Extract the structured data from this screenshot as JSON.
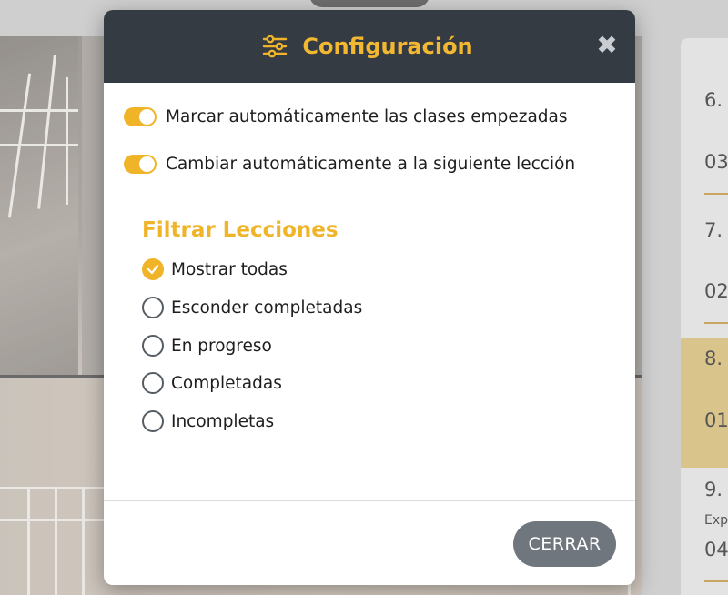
{
  "modal": {
    "title": "Configuración",
    "icon": "sliders-icon",
    "close_icon": "close-icon",
    "accent_color": "#f0b429",
    "header_color": "#353b42"
  },
  "toggles": [
    {
      "label": "Marcar automáticamente las clases empezadas",
      "on": true
    },
    {
      "label": "Cambiar automáticamente a la siguiente lección",
      "on": true
    }
  ],
  "filter": {
    "title": "Filtrar Lecciones",
    "options": [
      {
        "label": "Mostrar todas",
        "checked": true
      },
      {
        "label": "Esconder completadas",
        "checked": false
      },
      {
        "label": "En progreso",
        "checked": false
      },
      {
        "label": "Completadas",
        "checked": false
      },
      {
        "label": "Incompletas",
        "checked": false
      }
    ]
  },
  "footer": {
    "close_label": "CERRAR"
  },
  "background_lessons": [
    {
      "num": "6.",
      "time": "03"
    },
    {
      "num": "7.",
      "time": "02"
    },
    {
      "num": "8.",
      "time": "01"
    },
    {
      "num": "9.",
      "sub": "Exp",
      "time": "04"
    }
  ]
}
